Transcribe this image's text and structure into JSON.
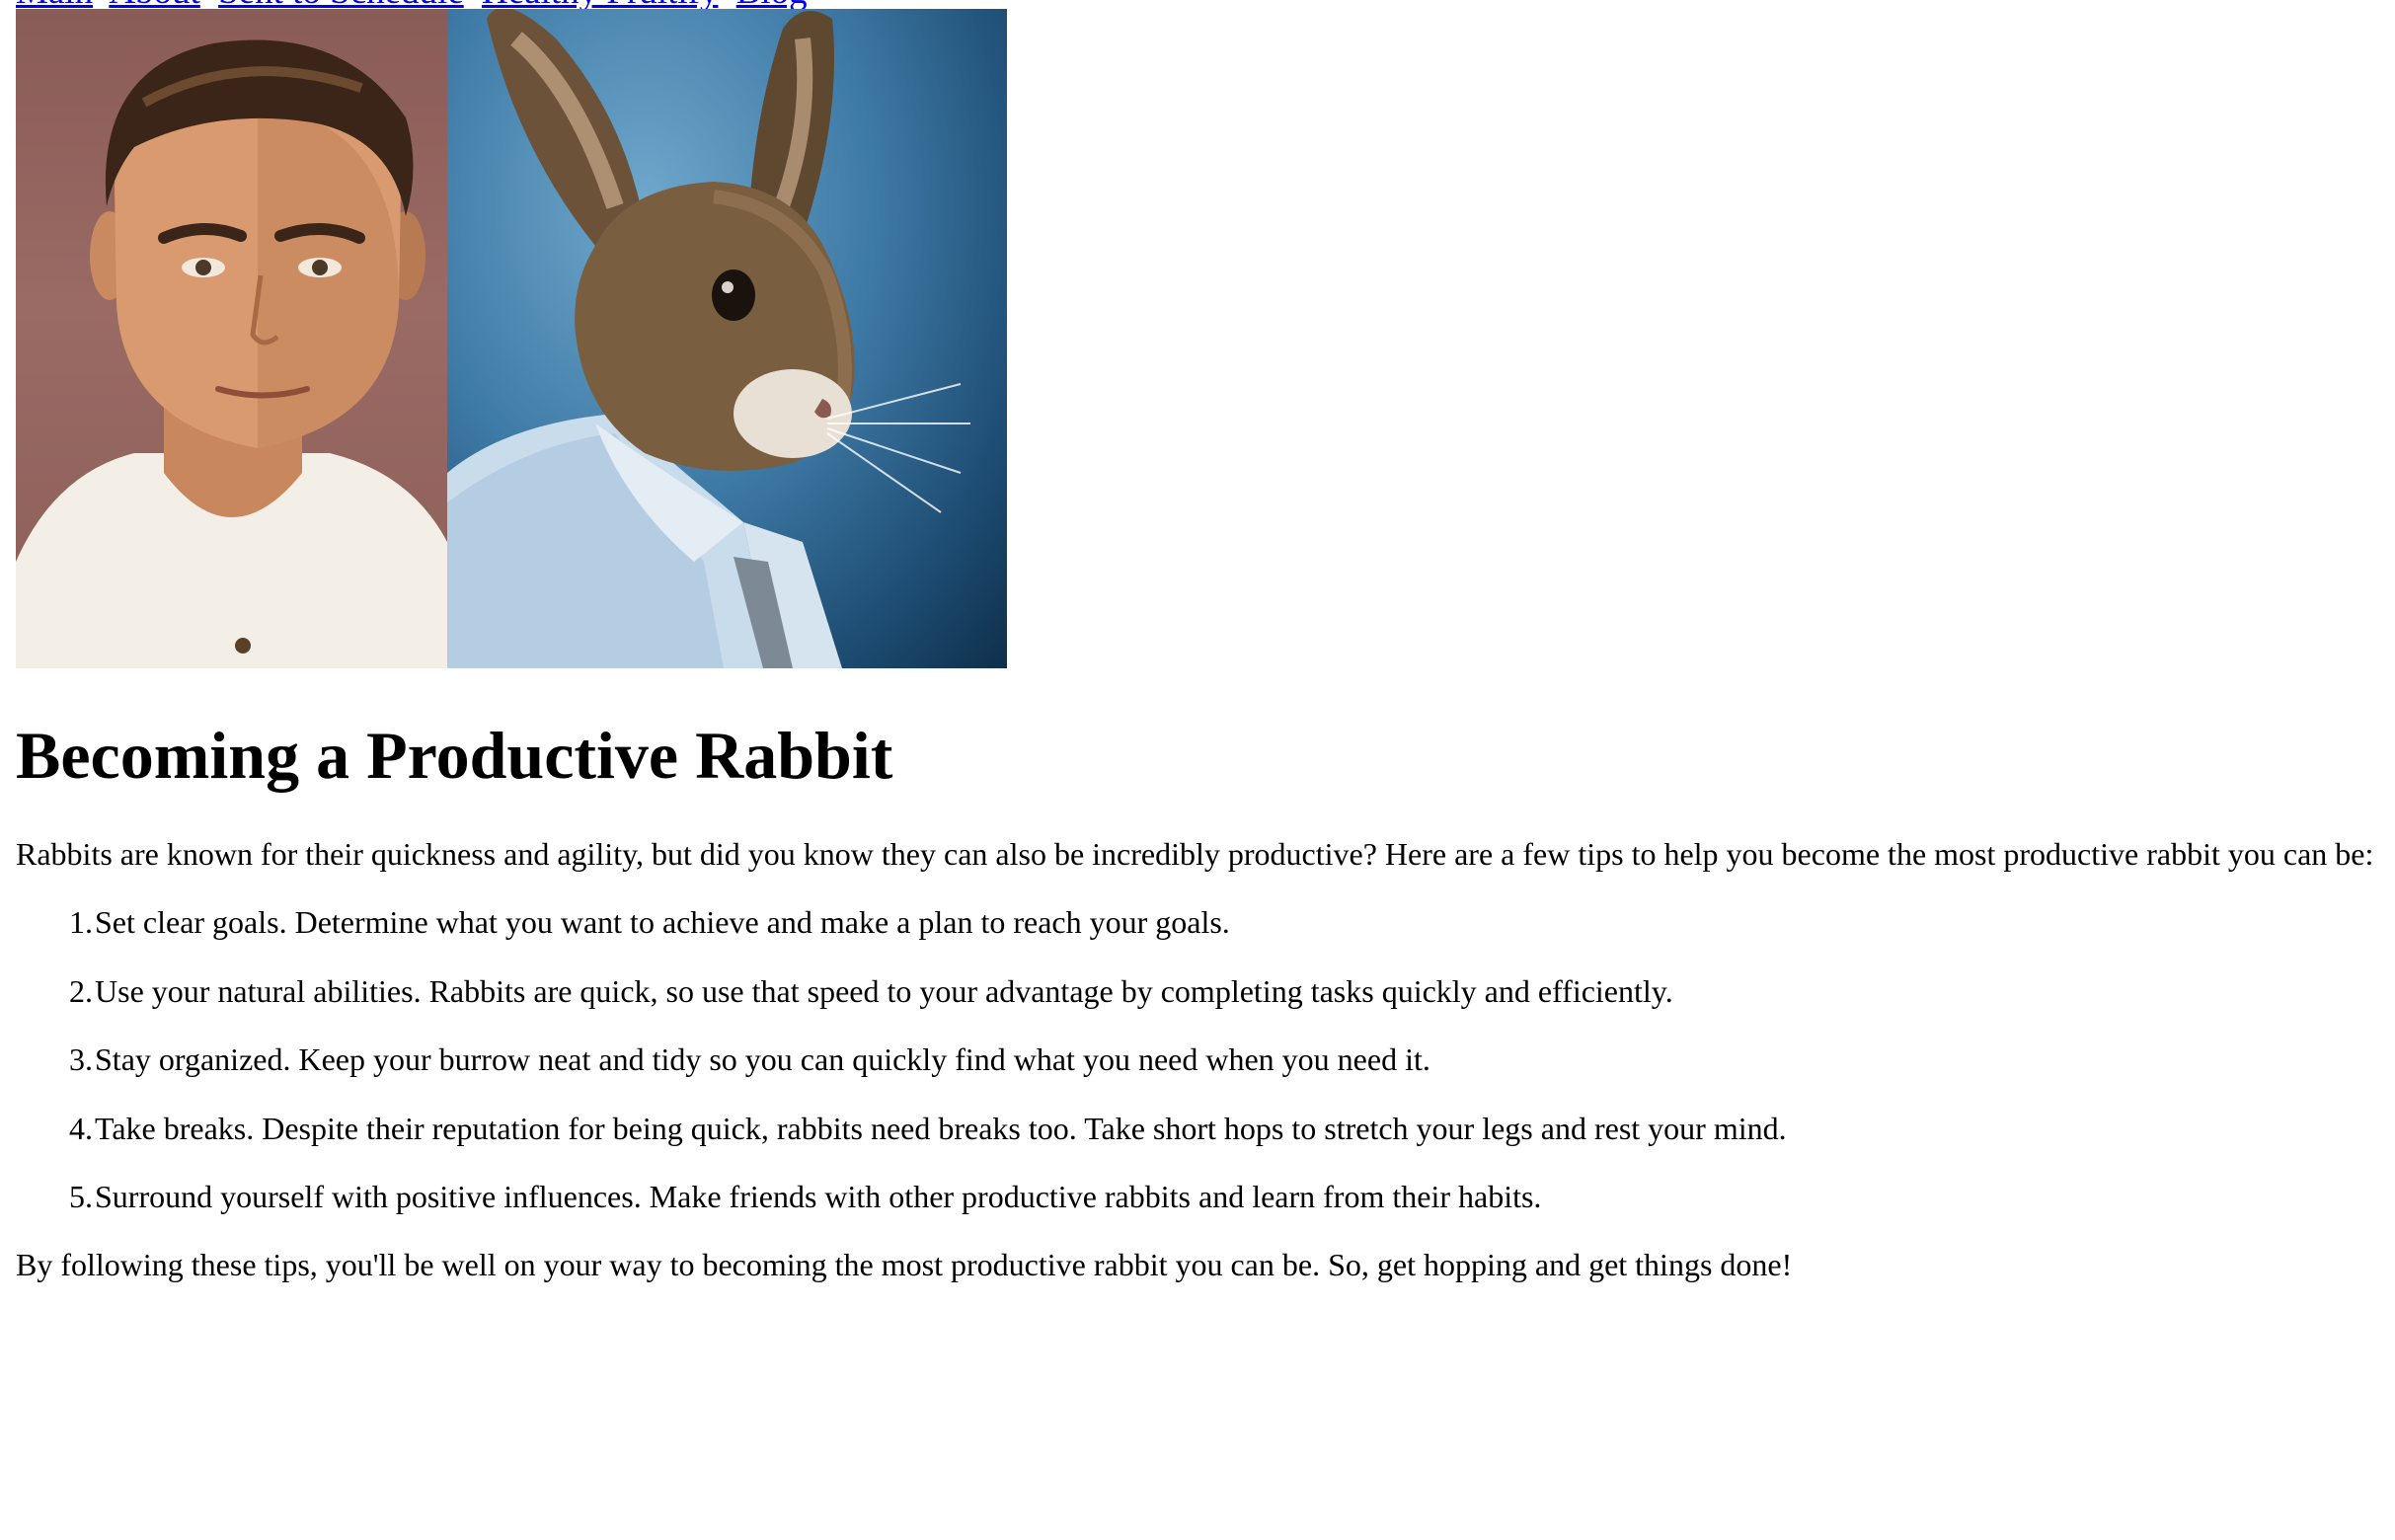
{
  "nav": {
    "links": [
      "Main",
      "About",
      "Sent to Schedule",
      "Healthy Fruitify",
      "Blog"
    ]
  },
  "hero": {
    "alt": "Man and rabbit in shirt portrait"
  },
  "article": {
    "title": "Becoming a Productive Rabbit",
    "intro": "Rabbits are known for their quickness and agility, but did you know they can also be incredibly productive? Here are a few tips to help you become the most productive rabbit you can be:",
    "tips": [
      {
        "num": "1.",
        "text": "Set clear goals. Determine what you want to achieve and make a plan to reach your goals."
      },
      {
        "num": "2.",
        "text": "Use your natural abilities. Rabbits are quick, so use that speed to your advantage by completing tasks quickly and efficiently."
      },
      {
        "num": "3.",
        "text": "Stay organized. Keep your burrow neat and tidy so you can quickly find what you need when you need it."
      },
      {
        "num": "4.",
        "text": "Take breaks. Despite their reputation for being quick, rabbits need breaks too. Take short hops to stretch your legs and rest your mind."
      },
      {
        "num": "5.",
        "text": "Surround yourself with positive influences. Make friends with other productive rabbits and learn from their habits."
      }
    ],
    "outro": "By following these tips, you'll be well on your way to becoming the most productive rabbit you can be. So, get hopping and get things done!"
  },
  "colors": {
    "link": "#0000ee",
    "text": "#000000",
    "background": "#ffffff"
  }
}
